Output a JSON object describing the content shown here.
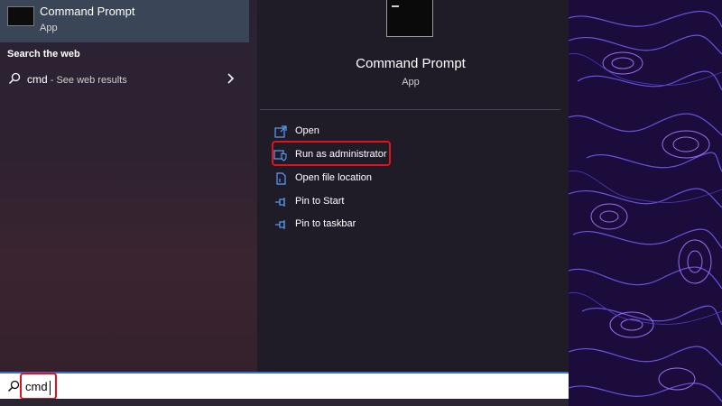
{
  "best_match": {
    "title": "Command Prompt",
    "subtitle": "App",
    "icon": "cmd-app-icon"
  },
  "web": {
    "heading": "Search the web",
    "query": "cmd",
    "suffix": " - See web results",
    "icon": "search-icon",
    "chevron": "chevron-right-icon"
  },
  "detail": {
    "title": "Command Prompt",
    "subtitle": "App"
  },
  "actions": [
    {
      "label": "Open",
      "icon": "open-icon"
    },
    {
      "label": "Run as administrator",
      "icon": "shield-icon"
    },
    {
      "label": "Open file location",
      "icon": "file-location-icon"
    },
    {
      "label": "Pin to Start",
      "icon": "pin-icon"
    },
    {
      "label": "Pin to taskbar",
      "icon": "pin-icon"
    }
  ],
  "search": {
    "value": "cmd"
  },
  "colors": {
    "highlight": "#e0121d",
    "selected_row": "#3a4658",
    "detail_bg": "#1f1b27",
    "wallpaper": "#1a0b3a"
  }
}
